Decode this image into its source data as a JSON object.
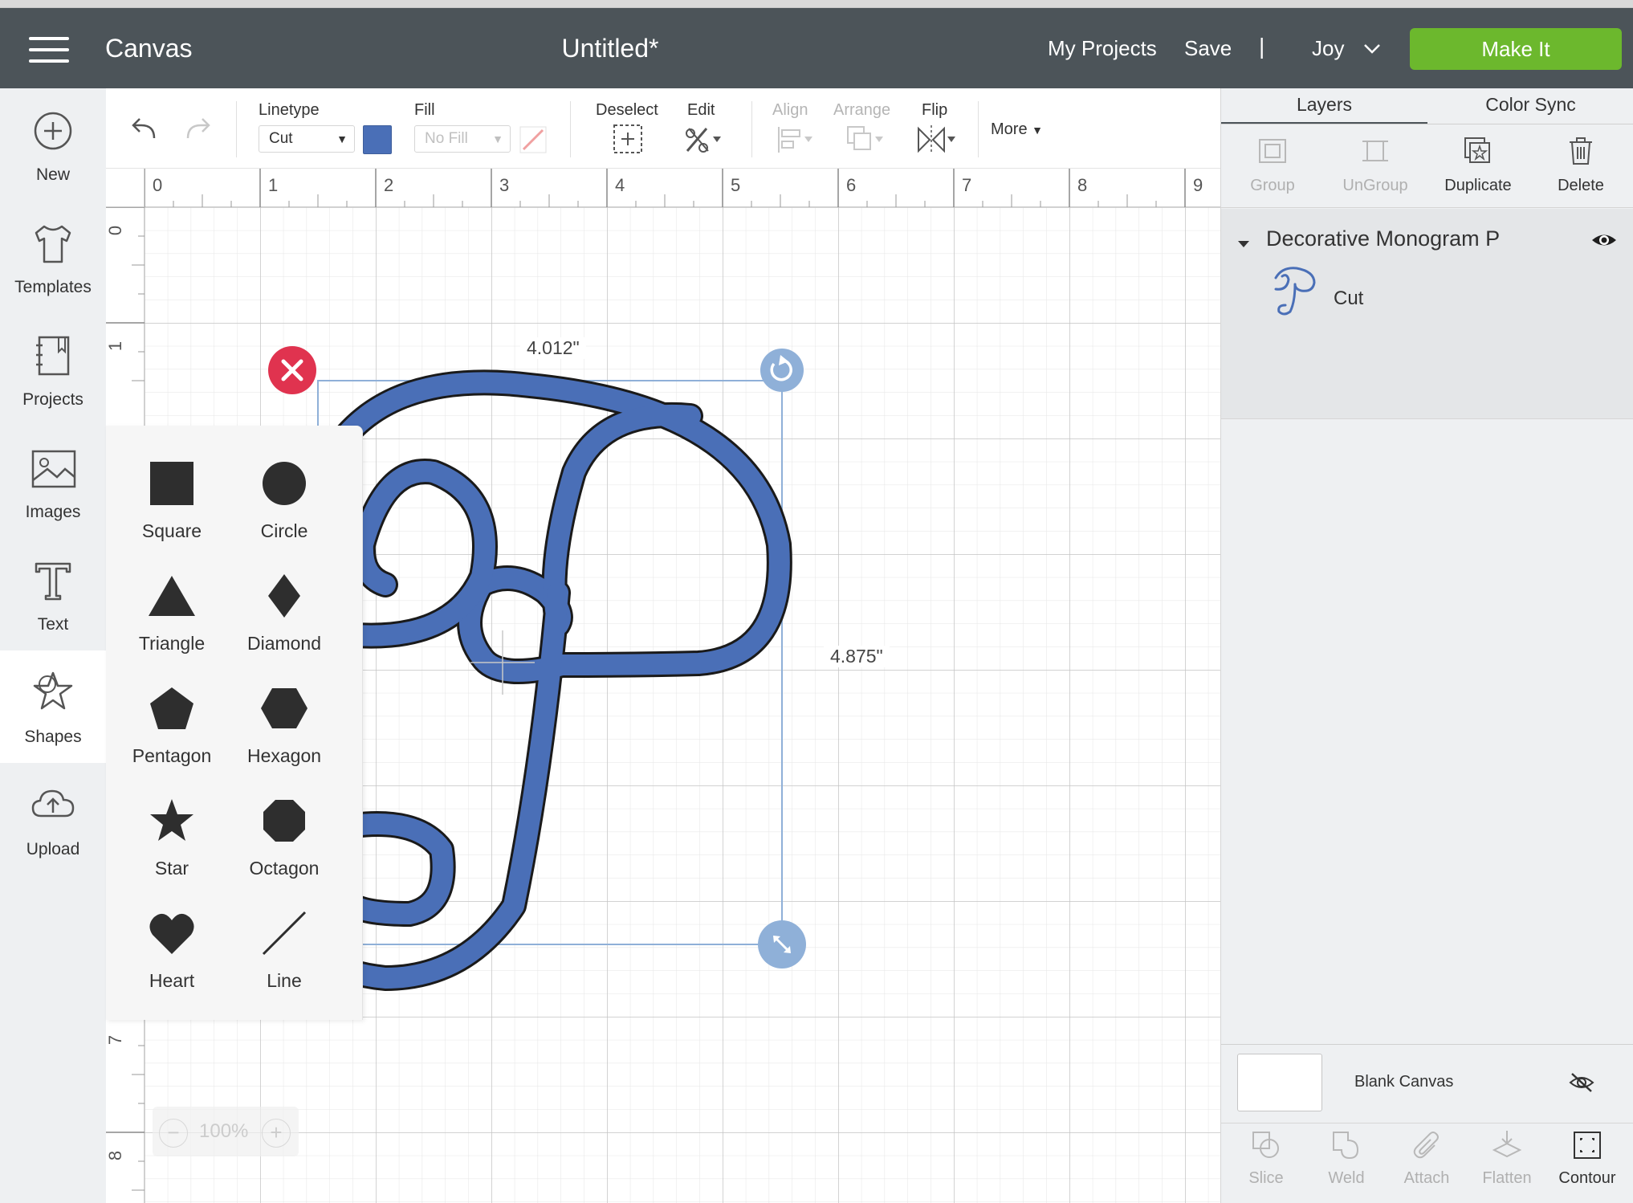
{
  "header": {
    "app_title": "Canvas",
    "doc_title": "Untitled*",
    "my_projects": "My Projects",
    "save": "Save",
    "separator": "|",
    "user": "Joy",
    "make_it": "Make It",
    "make_it_color": "#6cb82d",
    "bar_color": "#4c5459"
  },
  "sidebar": {
    "items": [
      {
        "label": "New",
        "icon": "plus-circle-icon"
      },
      {
        "label": "Templates",
        "icon": "tshirt-icon"
      },
      {
        "label": "Projects",
        "icon": "notebook-icon"
      },
      {
        "label": "Images",
        "icon": "image-icon"
      },
      {
        "label": "Text",
        "icon": "text-t-icon"
      },
      {
        "label": "Shapes",
        "icon": "shapes-icon",
        "active": true
      },
      {
        "label": "Upload",
        "icon": "cloud-upload-icon"
      }
    ]
  },
  "toolbar": {
    "linetype_label": "Linetype",
    "linetype_value": "Cut",
    "fill_label": "Fill",
    "fill_value": "No Fill",
    "fill_color": "#4a6fb7",
    "deselect_label": "Deselect",
    "edit_label": "Edit",
    "align_label": "Align",
    "arrange_label": "Arrange",
    "flip_label": "Flip",
    "more_label": "More"
  },
  "rulers": {
    "horizontal": [
      "0",
      "1",
      "2",
      "3",
      "4",
      "5",
      "6",
      "7",
      "8",
      "9"
    ],
    "vertical": [
      "0",
      "1",
      "7",
      "8"
    ]
  },
  "selection": {
    "width_label": "4.012\"",
    "height_label": "4.875\""
  },
  "shapes_panel": {
    "items": [
      {
        "label": "Square"
      },
      {
        "label": "Circle"
      },
      {
        "label": "Triangle"
      },
      {
        "label": "Diamond"
      },
      {
        "label": "Pentagon"
      },
      {
        "label": "Hexagon"
      },
      {
        "label": "Star"
      },
      {
        "label": "Octagon"
      },
      {
        "label": "Heart"
      },
      {
        "label": "Line"
      }
    ]
  },
  "zoom": {
    "minus": "−",
    "value": "100%",
    "plus": "+"
  },
  "right_panel": {
    "tabs": [
      "Layers",
      "Color Sync"
    ],
    "actions": [
      {
        "label": "Group",
        "enabled": false
      },
      {
        "label": "UnGroup",
        "enabled": false
      },
      {
        "label": "Duplicate",
        "enabled": true
      },
      {
        "label": "Delete",
        "enabled": true
      }
    ],
    "layer_group": {
      "title": "Decorative Monogram P",
      "layer_label": "Cut"
    },
    "blank_canvas": "Blank Canvas",
    "bottom_actions": [
      {
        "label": "Slice",
        "enabled": false
      },
      {
        "label": "Weld",
        "enabled": false
      },
      {
        "label": "Attach",
        "enabled": false
      },
      {
        "label": "Flatten",
        "enabled": false
      },
      {
        "label": "Contour",
        "enabled": true
      }
    ]
  }
}
